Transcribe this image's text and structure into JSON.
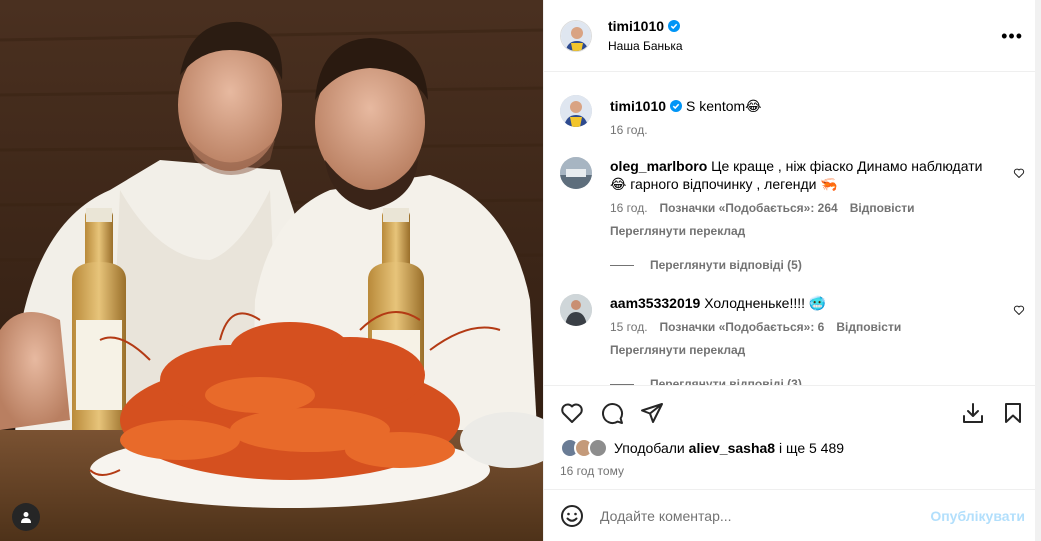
{
  "post": {
    "author": "timi1010",
    "location": "Наша Банька",
    "more_label": "•••"
  },
  "caption": {
    "author": "timi1010",
    "text": "S kentom😂",
    "time": "16 год."
  },
  "comments": [
    {
      "user": "oleg_marlboro",
      "text": "Це краще , ніж фіаско Динамо наблюдати😂 гарного відпочинку , легенди 🦐",
      "time": "16 год.",
      "likes": "Позначки «Подобається»: 264",
      "reply": "Відповісти",
      "translate": "Переглянути переклад",
      "replies": "Переглянути відповіді (5)"
    },
    {
      "user": "aam35332019",
      "text": "Холодненьке!!!! 🥶",
      "time": "15 год.",
      "likes": "Позначки «Подобається»: 6",
      "reply": "Відповісти",
      "translate": "Переглянути переклад",
      "replies": "Переглянути відповіді (3)"
    }
  ],
  "likes_summary": {
    "prefix": "Уподобали",
    "user": "aliev_sasha8",
    "suffix": "і ще 5 489",
    "time": "16 год тому"
  },
  "add_comment": {
    "placeholder": "Додайте коментар...",
    "post_label": "Опублікувати"
  },
  "icons": {
    "like": "heart-icon",
    "comment": "comment-icon",
    "share": "paper-plane-icon",
    "download": "download-icon",
    "save": "bookmark-icon",
    "emoji": "smiley-icon",
    "verified": "verified-badge-icon",
    "user_tag": "user-icon"
  },
  "colors": {
    "verified": "#0095f6",
    "post_button_disabled": "#b2dffc",
    "secondary_text": "#737373"
  }
}
